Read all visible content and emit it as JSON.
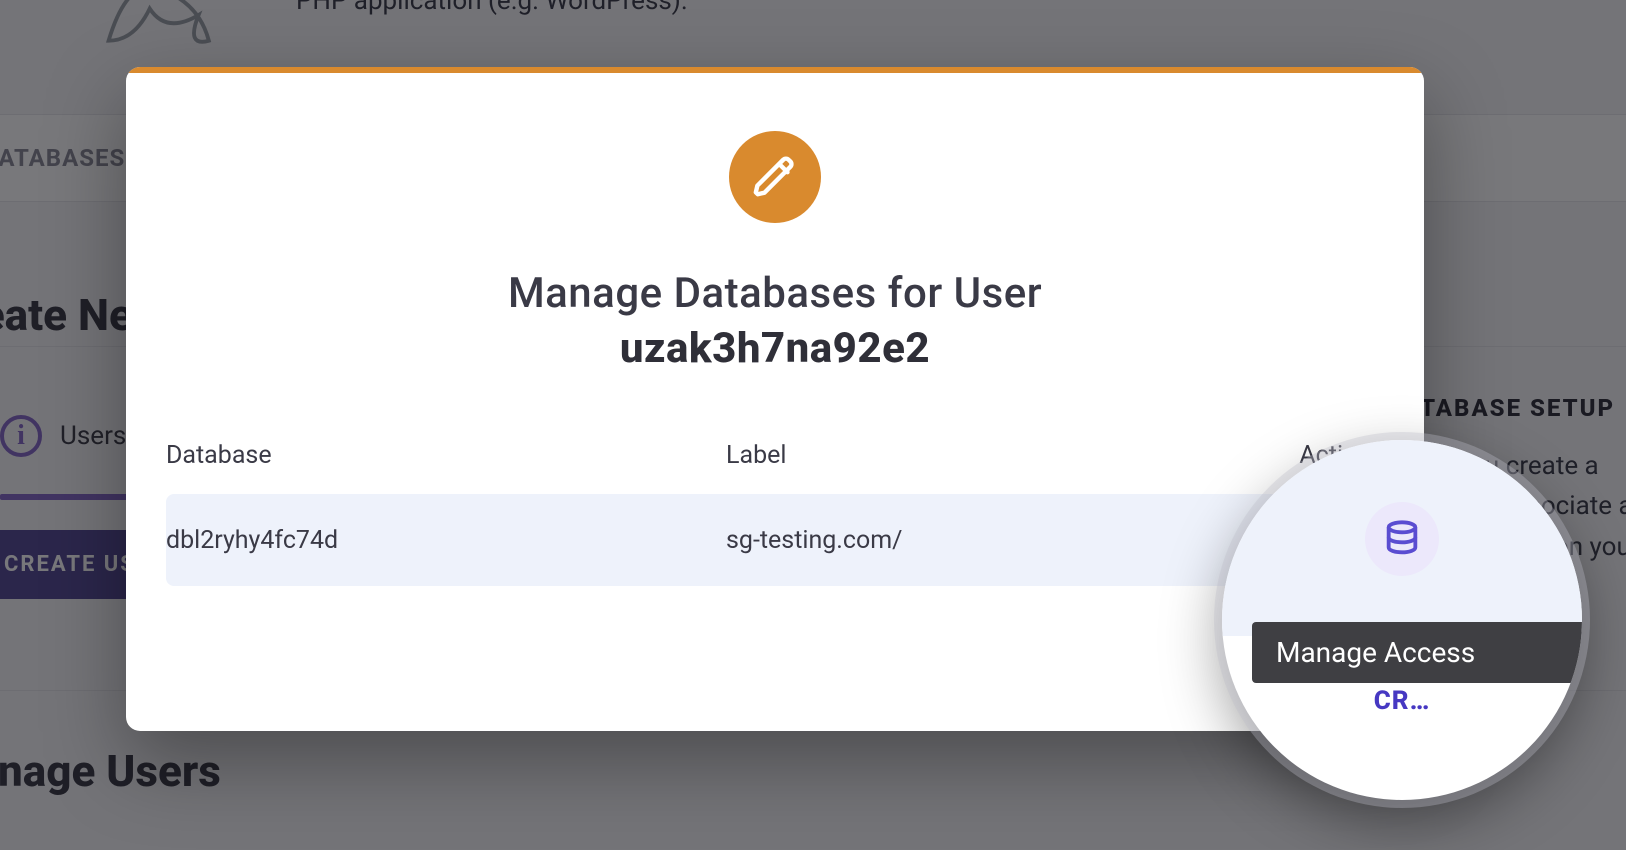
{
  "background": {
    "description_line2": "PHP application (e.g. WordPress).",
    "tab_databases": "DATABASES",
    "create_new_heading": "Create New",
    "info_label": "Users",
    "create_user_btn": "CREATE USER",
    "manage_users_heading": "Manage Users",
    "right": {
      "title": "DATABASE SETUP",
      "body": "When you create a database associate a user with it so on your local...",
      "link": "CREATE"
    }
  },
  "modal": {
    "title": "Manage Databases for User",
    "user": "uzak3h7na92e2",
    "columns": {
      "database": "Database",
      "label": "Label",
      "actions": "Actions"
    },
    "rows": [
      {
        "database": "dbl2ryhy4fc74d",
        "label": "sg-testing.com/"
      }
    ]
  },
  "spotlight": {
    "tooltip": "Manage Access",
    "under_text": "CR…"
  }
}
